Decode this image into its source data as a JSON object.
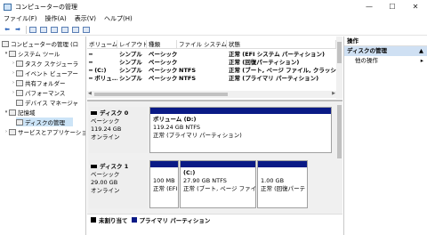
{
  "window": {
    "title": "コンピューターの管理",
    "minimize_glyph": "—",
    "maximize_glyph": "☐",
    "close_glyph": "✕"
  },
  "menu": [
    "ファイル(F)",
    "操作(A)",
    "表示(V)",
    "ヘルプ(H)"
  ],
  "tree": {
    "root": "コンピューターの管理 (ロ",
    "system_tools": "システム ツール",
    "task_scheduler": "タスク スケジューラ",
    "event_viewer": "イベント ビューアー",
    "shared_folders": "共有フォルダー",
    "performance": "パフォーマンス",
    "device_manager": "デバイス マネージャ",
    "storage": "記憶域",
    "disk_management": "ディスクの管理",
    "services_apps": "サービスとアプリケーショ"
  },
  "volume_list": {
    "headers": [
      "ボリューム",
      "レイアウト",
      "種類",
      "ファイル システム",
      "状態"
    ],
    "rows": [
      {
        "volume": "",
        "layout": "シンプル",
        "type": "ベーシック",
        "fs": "",
        "status": "正常 (EFI システム パーティション)"
      },
      {
        "volume": "",
        "layout": "シンプル",
        "type": "ベーシック",
        "fs": "",
        "status": "正常 (回復パーティション)"
      },
      {
        "volume": "(C:)",
        "layout": "シンプル",
        "type": "ベーシック",
        "fs": "NTFS",
        "status": "正常 (ブート, ページ ファイル, クラッシュ ダ"
      },
      {
        "volume": "ボリュ...",
        "layout": "シンプル",
        "type": "ベーシック",
        "fs": "NTFS",
        "status": "正常 (プライマリ パーティション)"
      }
    ]
  },
  "disks": [
    {
      "name": "ディスク 0",
      "type": "ベーシック",
      "size": "119.24 GB",
      "state": "オンライン",
      "partitions": [
        {
          "name": "ボリューム (D:)",
          "size": "119.24 GB NTFS",
          "status": "正常 (プライマリ パーティション)"
        }
      ]
    },
    {
      "name": "ディスク 1",
      "type": "ベーシック",
      "size": "29.00 GB",
      "state": "オンライン",
      "partitions": [
        {
          "name": "",
          "size": "100 MB",
          "status": "正常 (EFI"
        },
        {
          "name": "(C:)",
          "size": "27.90 GB NTFS",
          "status": "正常 (ブート, ページ ファイ"
        },
        {
          "name": "",
          "size": "1.00 GB",
          "status": "正常 (回復パーテ"
        }
      ]
    }
  ],
  "legend": {
    "unallocated": "未割り当て",
    "primary": "プライマリ パーティション",
    "unallocated_color": "#000000",
    "primary_color": "#0a1a86"
  },
  "actions": {
    "header": "操作",
    "section": "ディスクの管理",
    "more": "他の操作"
  }
}
